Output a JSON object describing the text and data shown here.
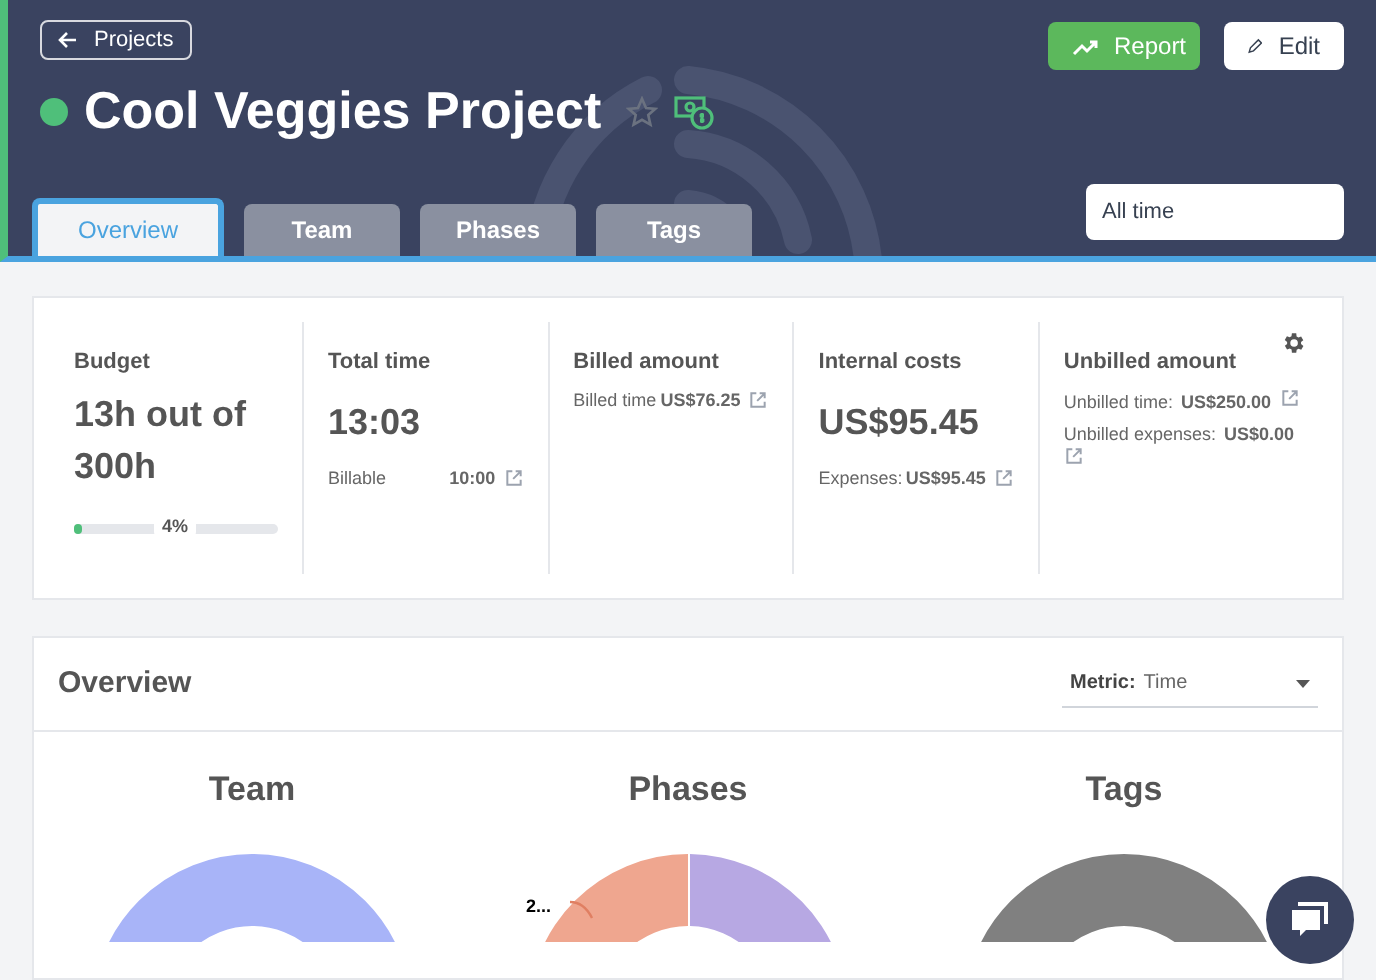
{
  "header": {
    "back_link": "Projects",
    "title": "Cool Veggies Project",
    "active": true,
    "starred": false,
    "buttons": [
      {
        "kind": "report",
        "label": "Report"
      },
      {
        "kind": "edit",
        "label": "Edit"
      }
    ],
    "tabs": [
      {
        "label": "Overview",
        "selected": true
      },
      {
        "label": "Team",
        "selected": false
      },
      {
        "label": "Phases",
        "selected": false
      },
      {
        "label": "Tags",
        "selected": false
      }
    ],
    "date_range": {
      "value": "All time"
    }
  },
  "stats": [
    {
      "kind": "budget",
      "title": "Budget",
      "value": "13h out of 300h",
      "level": 0.04,
      "reading": "4%"
    },
    {
      "kind": "main",
      "title": "Total time",
      "value": "13:03",
      "lines": [
        {
          "label": "Billable",
          "amount": "10:00"
        }
      ]
    },
    {
      "kind": "lines",
      "title": "Billed amount",
      "lines": [
        {
          "label": "Billed time",
          "amount": "US$76.25"
        }
      ]
    },
    {
      "kind": "main",
      "title": "Internal costs",
      "value": "US$95.45",
      "lines": [
        {
          "label": "Expenses:",
          "amount": "US$95.45"
        }
      ]
    },
    {
      "kind": "stacked",
      "title": "Unbilled amount",
      "lines": [
        {
          "label": "Unbilled time:",
          "amount": "US$250.00"
        },
        {
          "label": "Unbilled expenses:",
          "amount": "US$0.00"
        }
      ]
    }
  ],
  "overview": {
    "title": "Overview",
    "metric": {
      "label": "Metric:",
      "value": "Time"
    },
    "charts": [
      {
        "title": "Team",
        "kind": "full"
      },
      {
        "title": "Phases",
        "kind": "split",
        "label": "2..."
      },
      {
        "title": "Tags",
        "kind": "gray"
      }
    ]
  }
}
